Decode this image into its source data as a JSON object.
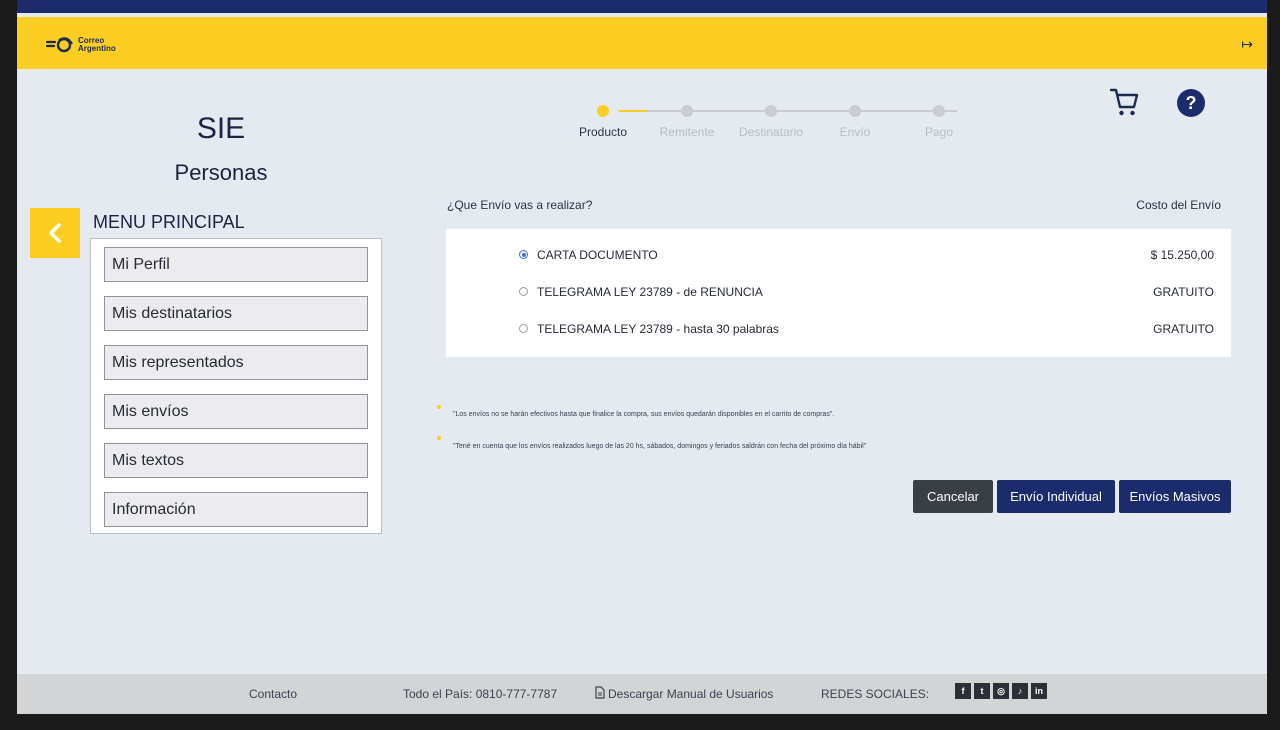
{
  "header": {
    "logo_line1": "Correo",
    "logo_line2": "Argentino",
    "logout_symbol": "↦"
  },
  "app": {
    "title": "SIE",
    "subtitle": "Personas"
  },
  "menu": {
    "title": "MENU PRINCIPAL",
    "items": [
      {
        "label": "Mi Perfil"
      },
      {
        "label": "Mis destinatarios"
      },
      {
        "label": "Mis representados"
      },
      {
        "label": "Mis envíos"
      },
      {
        "label": "Mis textos"
      },
      {
        "label": "Información"
      }
    ]
  },
  "stepper": {
    "current_index": 0,
    "steps": [
      {
        "label": "Producto"
      },
      {
        "label": "Remitente"
      },
      {
        "label": "Destinatario"
      },
      {
        "label": "Envío"
      },
      {
        "label": "Pago"
      }
    ]
  },
  "form": {
    "question": "¿Que Envío vas a realizar?",
    "cost_header": "Costo del Envío",
    "options": [
      {
        "label": "CARTA DOCUMENTO",
        "price": "$ 15.250,00",
        "selected": true
      },
      {
        "label": "TELEGRAMA LEY 23789 - de RENUNCIA",
        "price": "GRATUITO",
        "selected": false
      },
      {
        "label": "TELEGRAMA LEY 23789 - hasta 30 palabras",
        "price": "GRATUITO",
        "selected": false
      }
    ]
  },
  "notes": [
    "\"Los envíos no se harán efectivos hasta que finalice la compra, sus envíos quedarán disponibles en el carrito de compras\".",
    "\"Tené en cuenta que los envíos realizados luego de las 20 hs, sábados, domingos y feriados saldrán con fecha del próximo día hábil\""
  ],
  "actions": {
    "cancel": "Cancelar",
    "individual": "Envío Individual",
    "masivo": "Envíos Masivos"
  },
  "footer": {
    "contact": "Contacto",
    "phone": "Todo el País: 0810-777-7787",
    "manual": "Descargar Manual de Usuarios",
    "social_label": "REDES SOCIALES:",
    "social": [
      {
        "name": "facebook-icon",
        "glyph": "f"
      },
      {
        "name": "twitter-icon",
        "glyph": "t"
      },
      {
        "name": "instagram-icon",
        "glyph": "◎"
      },
      {
        "name": "tiktok-icon",
        "glyph": "♪"
      },
      {
        "name": "linkedin-icon",
        "glyph": "in"
      }
    ]
  },
  "colors": {
    "brand_yellow": "#fccd22",
    "brand_navy": "#1c2b6b",
    "background": "#e5e9f0",
    "radio_selected": "#3d6fe0"
  }
}
